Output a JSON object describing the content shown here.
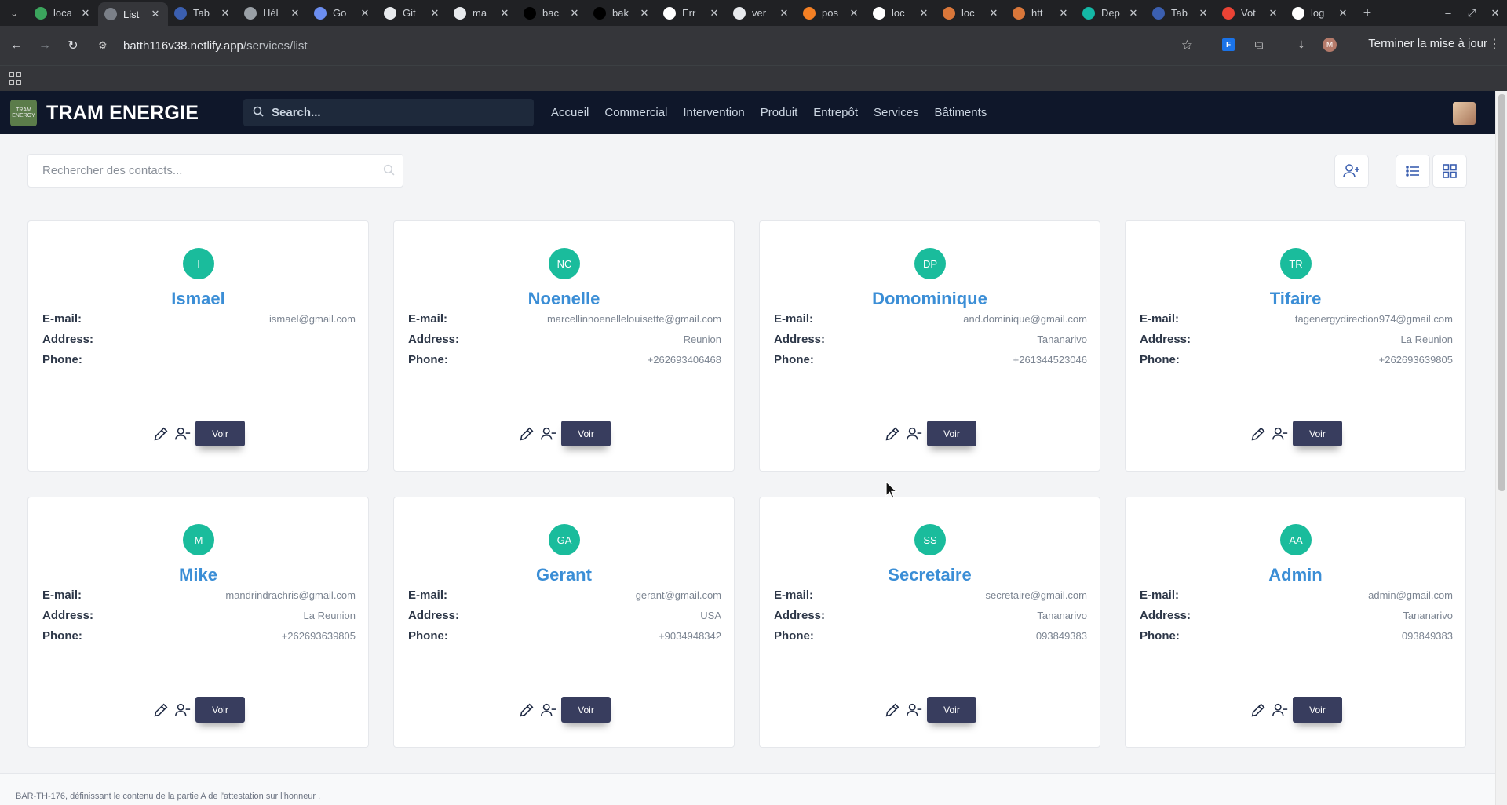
{
  "browser": {
    "tabs": [
      {
        "title": "loca",
        "icon": "mountain-icon",
        "active": false
      },
      {
        "title": "List",
        "icon": "globe-icon",
        "active": true
      },
      {
        "title": "Tab",
        "icon": "tab-icon",
        "active": false
      },
      {
        "title": "Hél",
        "icon": "openai-icon",
        "active": false
      },
      {
        "title": "Go",
        "icon": "gemini-icon",
        "active": false
      },
      {
        "title": "Git",
        "icon": "github-icon",
        "active": false
      },
      {
        "title": "ma",
        "icon": "github-icon",
        "active": false
      },
      {
        "title": "bac",
        "icon": "netlify-icon",
        "active": false
      },
      {
        "title": "bak",
        "icon": "vercel-icon",
        "active": false
      },
      {
        "title": "Err",
        "icon": "google-icon",
        "active": false
      },
      {
        "title": "ver",
        "icon": "github-icon",
        "active": false
      },
      {
        "title": "pos",
        "icon": "stackoverflow-icon",
        "active": false
      },
      {
        "title": "loc",
        "icon": "google-icon",
        "active": false
      },
      {
        "title": "loc",
        "icon": "tram-icon",
        "active": false
      },
      {
        "title": "htt",
        "icon": "tram-icon",
        "active": false
      },
      {
        "title": "Dep",
        "icon": "deploy-icon",
        "active": false
      },
      {
        "title": "Tab",
        "icon": "tab-icon",
        "active": false
      },
      {
        "title": "Vot",
        "icon": "gmail-icon",
        "active": false
      },
      {
        "title": "log",
        "icon": "google-icon",
        "active": false
      }
    ],
    "address": {
      "host": "batth116v38.netlify.app",
      "path": "/services/list"
    },
    "update_label": "Terminer la mise à jour",
    "profile_initial": "M"
  },
  "app": {
    "brand": "TRAM ENERGIE",
    "logo_text": "TRAM ENERGY",
    "search_placeholder": "Search...",
    "nav": [
      "Accueil",
      "Commercial",
      "Intervention",
      "Produit",
      "Entrepôt",
      "Services",
      "Bâtiments"
    ]
  },
  "toolbar": {
    "contact_search_placeholder": "Rechercher des contacts..."
  },
  "labels": {
    "email": "E-mail:",
    "address": "Address:",
    "phone": "Phone:",
    "voir": "Voir"
  },
  "contacts": [
    {
      "initials": "I",
      "name": "Ismael",
      "email": "ismael@gmail.com",
      "address": "",
      "phone": ""
    },
    {
      "initials": "NC",
      "name": "Noenelle",
      "email": "marcellinnoenellelouisette@gmail.com",
      "address": "Reunion",
      "phone": "+262693406468"
    },
    {
      "initials": "DP",
      "name": "Domominique",
      "email": "and.dominique@gmail.com",
      "address": "Tananarivo",
      "phone": "+261344523046"
    },
    {
      "initials": "TR",
      "name": "Tifaire",
      "email": "tagenergydirection974@gmail.com",
      "address": "La Reunion",
      "phone": "+262693639805"
    },
    {
      "initials": "M",
      "name": "Mike",
      "email": "mandrindrachris@gmail.com",
      "address": "La Reunion",
      "phone": "+262693639805"
    },
    {
      "initials": "GA",
      "name": "Gerant",
      "email": "gerant@gmail.com",
      "address": "USA",
      "phone": "+9034948342"
    },
    {
      "initials": "SS",
      "name": "Secretaire",
      "email": "secretaire@gmail.com",
      "address": "Tananarivo",
      "phone": "093849383"
    },
    {
      "initials": "AA",
      "name": "Admin",
      "email": "admin@gmail.com",
      "address": "Tananarivo",
      "phone": "093849383"
    }
  ],
  "footer": {
    "text": "BAR-TH-176, définissant le contenu de la partie A de l'attestation sur l'honneur ."
  },
  "colors": {
    "navbar": "#0f172a",
    "avatar": "#1abc9c",
    "name": "#3b8ed6",
    "voir_button": "#383d5e"
  }
}
